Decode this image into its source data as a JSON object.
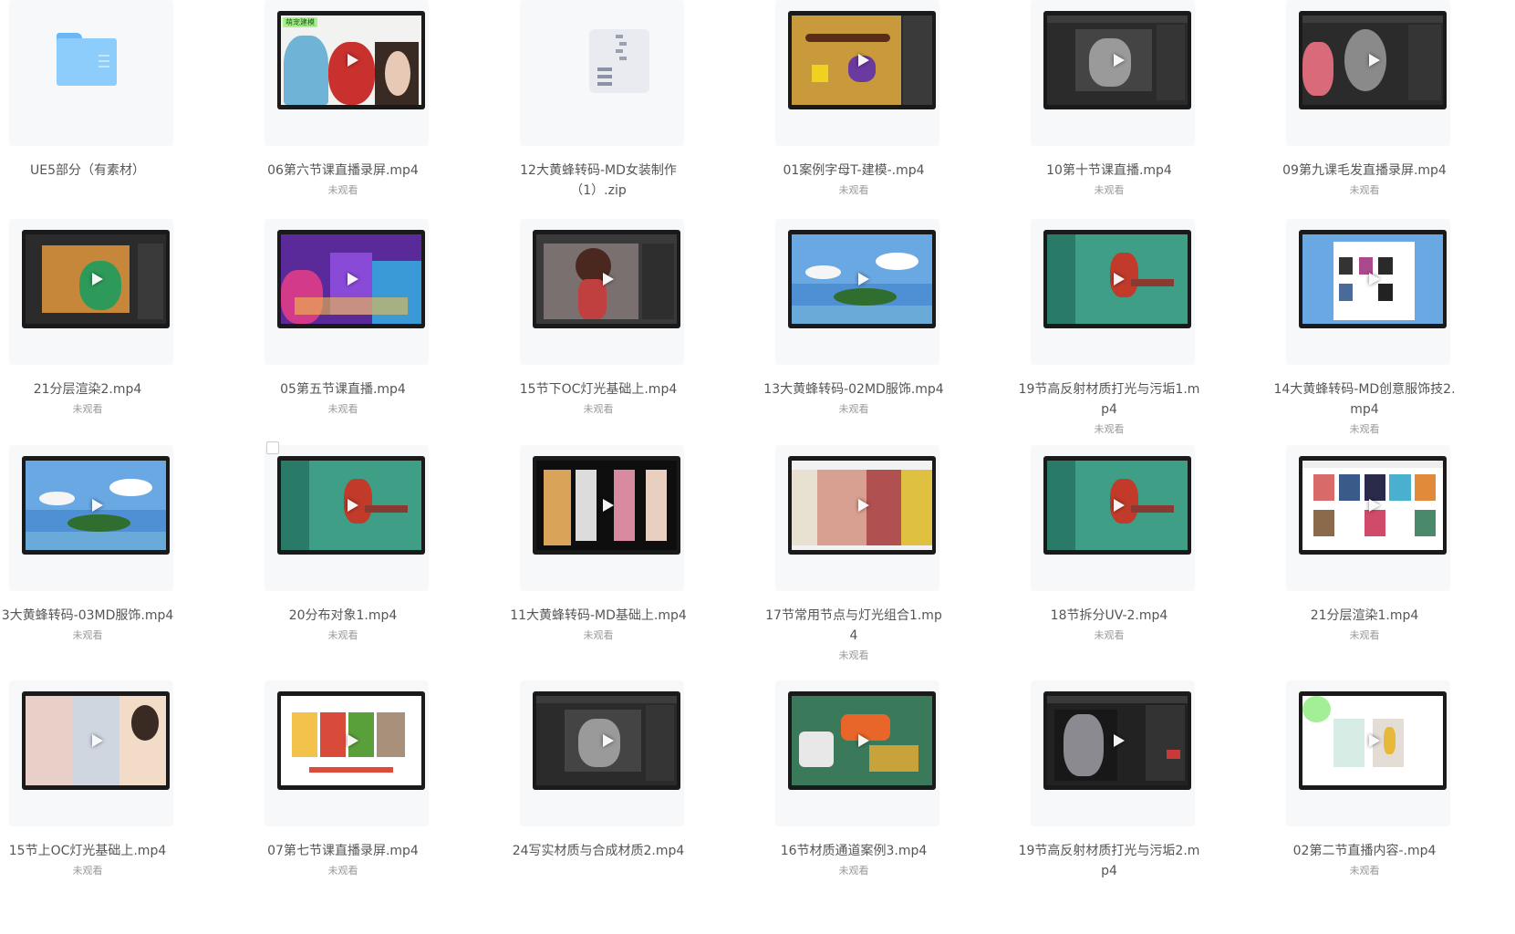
{
  "grid": [
    {
      "name": "UE5部分（有素材）",
      "status": "",
      "type": "folder"
    },
    {
      "name": "06第六节课直播录屏.mp4",
      "status": "未观看",
      "type": "video",
      "thumb": "figures-cream",
      "badge": "萌宠建模"
    },
    {
      "name": "12大黄蜂转码-MD女装制作（1）.zip",
      "status": "",
      "type": "zip"
    },
    {
      "name": "01案例字母T-建模-.mp4",
      "status": "未观看",
      "type": "video",
      "thumb": "yellow-board"
    },
    {
      "name": "10第十节课直播.mp4",
      "status": "未观看",
      "type": "video",
      "thumb": "dark-ui-grey"
    },
    {
      "name": "09第九课毛发直播录屏.mp4",
      "status": "未观看",
      "type": "video",
      "thumb": "dark-ui-face"
    },
    {
      "name": "21分层渲染2.mp4",
      "status": "未观看",
      "type": "video",
      "thumb": "orange-room"
    },
    {
      "name": "05第五节课直播.mp4",
      "status": "未观看",
      "type": "video",
      "thumb": "purple-neon"
    },
    {
      "name": "15节下OC灯光基础上.mp4",
      "status": "未观看",
      "type": "video",
      "thumb": "doll-grey"
    },
    {
      "name": "13大黄蜂转码-02MD服饰.mp4",
      "status": "未观看",
      "type": "video",
      "thumb": "sky-island"
    },
    {
      "name": "19节高反射材质打光与污垢1.mp4",
      "status": "未观看",
      "type": "video",
      "thumb": "teal-red"
    },
    {
      "name": "14大黄蜂转码-MD创意服饰技2.mp4",
      "status": "未观看",
      "type": "video",
      "thumb": "sky-browser"
    },
    {
      "name": "3大黄蜂转码-03MD服饰.mp4",
      "status": "未观看",
      "type": "video",
      "thumb": "sky-island"
    },
    {
      "name": "20分布对象1.mp4",
      "status": "未观看",
      "type": "video",
      "thumb": "teal-red",
      "checkbox": true
    },
    {
      "name": "11大黄蜂转码-MD基础上.mp4",
      "status": "未观看",
      "type": "video",
      "thumb": "fashion-dark"
    },
    {
      "name": "17节常用节点与灯光组合1.mp4",
      "status": "未观看",
      "type": "video",
      "thumb": "warm-rooms"
    },
    {
      "name": "18节拆分UV-2.mp4",
      "status": "未观看",
      "type": "video",
      "thumb": "teal-red"
    },
    {
      "name": "21分层渲染1.mp4",
      "status": "未观看",
      "type": "video",
      "thumb": "web-gallery"
    },
    {
      "name": "15节上OC灯光基础上.mp4",
      "status": "未观看",
      "type": "video",
      "thumb": "photo-people"
    },
    {
      "name": "07第七节课直播录屏.mp4",
      "status": "未观看",
      "type": "video",
      "thumb": "figures-white"
    },
    {
      "name": "24写实材质与合成材质2.mp4",
      "status": "",
      "type": "video",
      "thumb": "dark-ui-grey"
    },
    {
      "name": "16节材质通道案例3.mp4",
      "status": "未观看",
      "type": "video",
      "thumb": "green-3d"
    },
    {
      "name": "19节高反射材质打光与污垢2.mp4",
      "status": "",
      "type": "video",
      "thumb": "robot-dark"
    },
    {
      "name": "02第二节直播内容-.mp4",
      "status": "未观看",
      "type": "video",
      "thumb": "white-chars"
    }
  ]
}
